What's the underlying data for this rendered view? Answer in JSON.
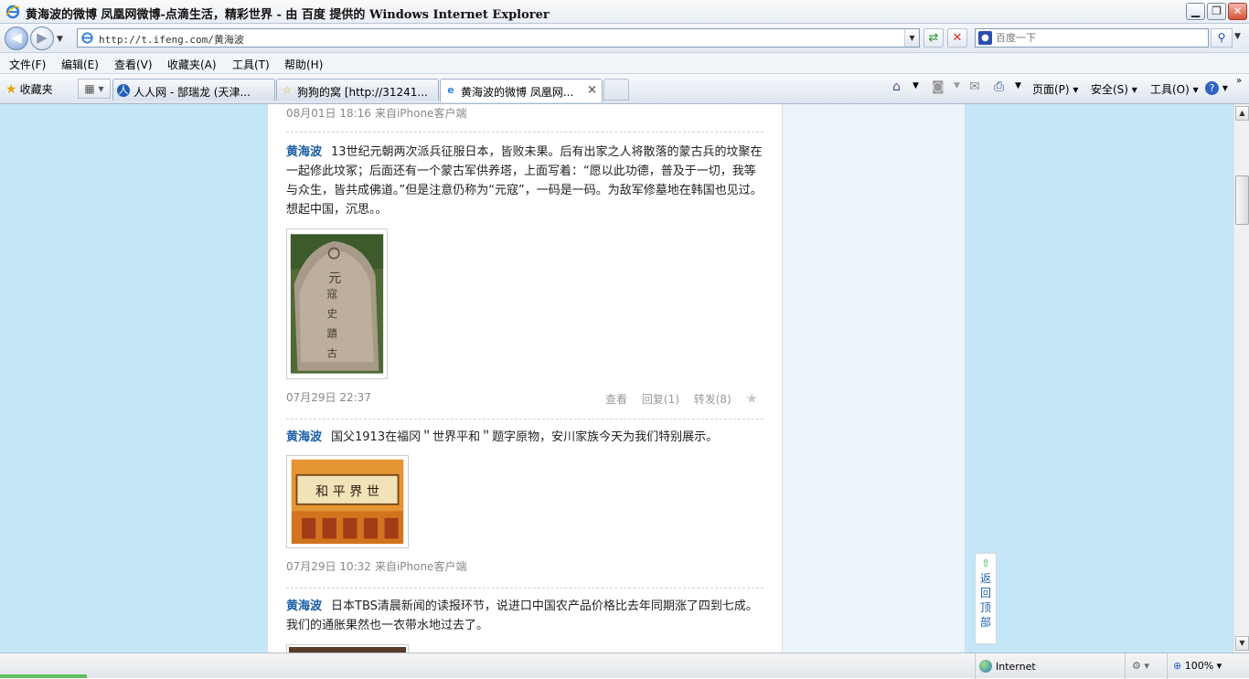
{
  "window": {
    "title": "黄海波的微博 凤凰网微博-点滴生活，精彩世界 - 由 百度 提供的 Windows Internet Explorer"
  },
  "address": {
    "url": "http://t.ifeng.com/黄海波",
    "search_placeholder": "百度一下"
  },
  "menu": [
    "文件(F)",
    "编辑(E)",
    "查看(V)",
    "收藏夹(A)",
    "工具(T)",
    "帮助(H)"
  ],
  "favorites_label": "收藏夹",
  "tabs": [
    {
      "label": "人人网 - 郜瑞龙 (天津..."
    },
    {
      "label": "狗狗的窝 [http://31241..."
    },
    {
      "label": "黄海波的微博 凤凰网..."
    }
  ],
  "commandbar": {
    "page": "页面(P)",
    "safety": "安全(S)",
    "tools": "工具(O)"
  },
  "feed": {
    "top_meta": {
      "time": "08月01日  18:16",
      "source": "来自iPhone客户端"
    },
    "posts": [
      {
        "author": "黄海波",
        "text": "13世纪元朝两次派兵征服日本，皆败未果。后有出家之人将散落的蒙古兵的坟聚在一起修此坟冢；后面还有一个蒙古军供养塔，上面写着：“愿以此功德，普及于一切，我等与众生，皆共成佛道。”但是注意仍称为“元寇”，一码是一码。为敌军修墓地在韩国也见过。想起中国，沉思。。",
        "time": "07月29日  22:37",
        "actions": {
          "view": "查看",
          "reply": "回复(1)",
          "forward": "转发(8)"
        }
      },
      {
        "author": "黄海波",
        "text": "国父1913在福冈＂世界平和＂题字原物，安川家族今天为我们特别展示。",
        "time": "07月29日  10:32",
        "source": "来自iPhone客户端",
        "calligraphy": "世界平和"
      },
      {
        "author": "黄海波",
        "text": "日本TBS清晨新闻的读报环节，说进口中国农产品价格比去年同期涨了四到七成。我们的通胀果然也一衣带水地过去了。"
      }
    ]
  },
  "back_to_top": [
    "返",
    "回",
    "顶",
    "部"
  ],
  "status": {
    "zone": "Internet",
    "zoom": "100%"
  },
  "colors": {
    "page_background": "#c4e6f6",
    "author_link": "#1a5fa5"
  },
  "icons": [
    "ie-logo-icon",
    "back-icon",
    "forward-icon",
    "refresh-icon",
    "stop-icon",
    "search-icon",
    "favorites-star-icon",
    "home-icon",
    "rss-icon",
    "mail-icon",
    "print-icon",
    "help-icon",
    "globe-icon",
    "zoom-icon"
  ]
}
